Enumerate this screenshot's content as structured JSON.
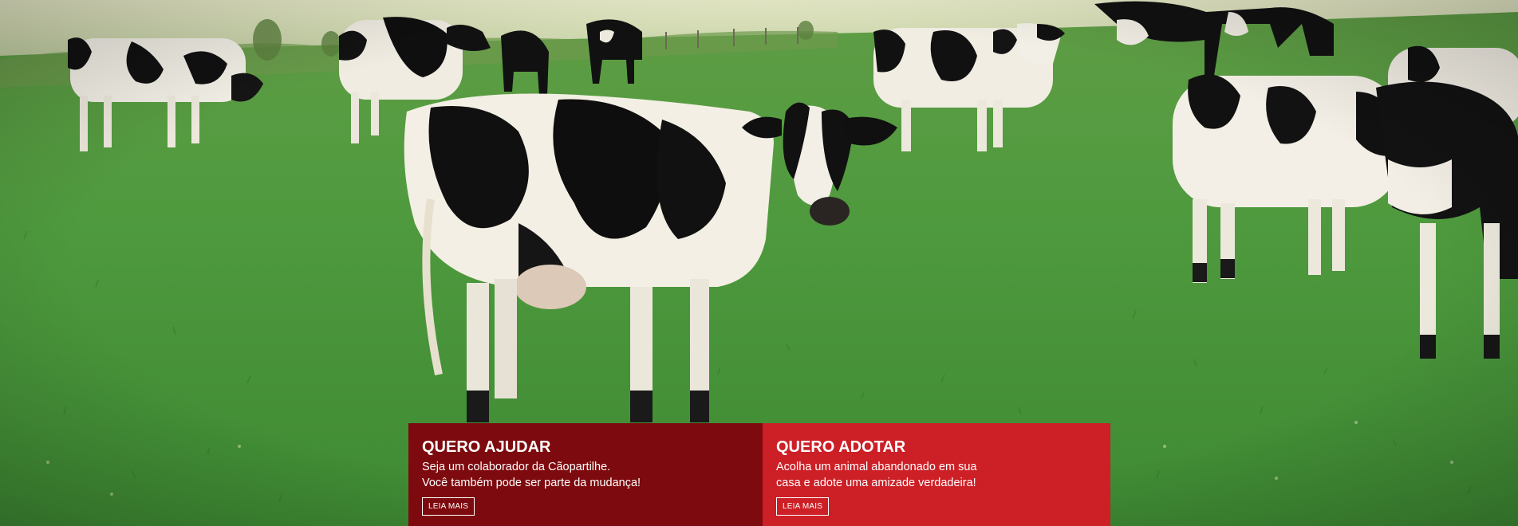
{
  "hero": {
    "image_subject": "cows-pasture"
  },
  "cta": {
    "help": {
      "title": "QUERO AJUDAR",
      "line1": "Seja um colaborador da Cãopartilhe.",
      "line2": "Você também pode ser parte da mudança!",
      "button_label": "LEIA MAIS",
      "color": "#7d0a0e"
    },
    "adopt": {
      "title": "QUERO ADOTAR",
      "line1": "Acolha um animal abandonado em sua",
      "line2": "casa e adote uma amizade verdadeira!",
      "button_label": "LEIA MAIS",
      "color": "#cc1f26"
    }
  }
}
